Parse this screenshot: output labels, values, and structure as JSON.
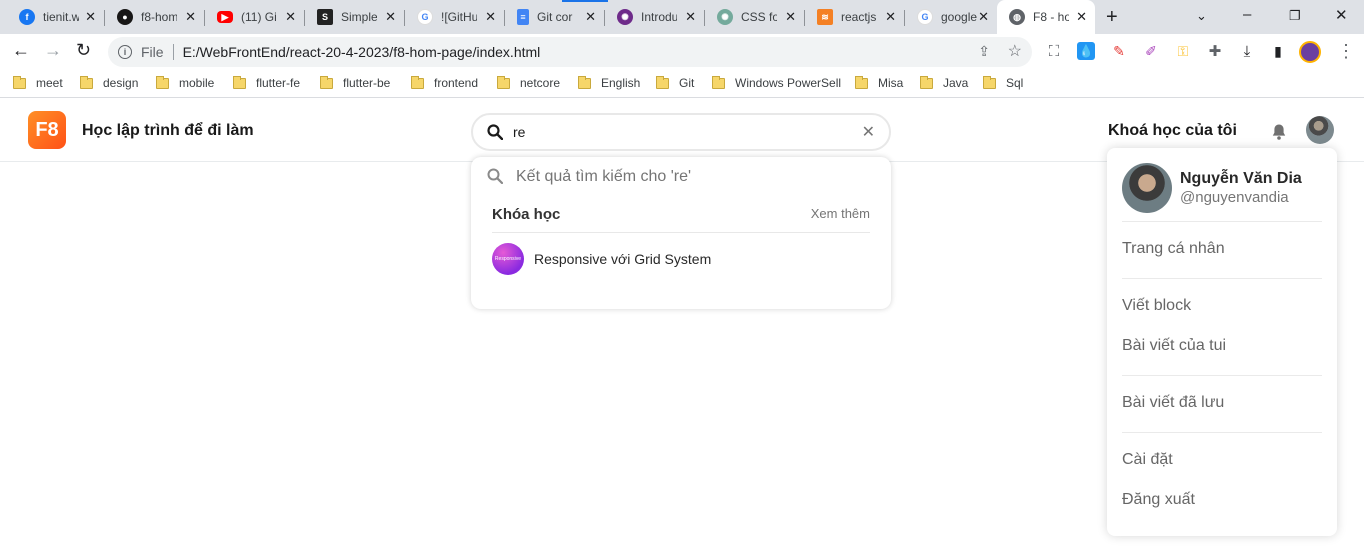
{
  "browser": {
    "tabs": [
      {
        "title": "tienit.w",
        "icon": "facebook-icon",
        "color": "#1877f2"
      },
      {
        "title": "f8-hom",
        "icon": "github-icon",
        "color": "#181717"
      },
      {
        "title": "(11) Gi",
        "icon": "youtube-icon",
        "color": "#ff0000"
      },
      {
        "title": "Simple",
        "icon": "bookmark-icon",
        "color": "#222222"
      },
      {
        "title": "![GitHu",
        "icon": "google-icon",
        "color": "#4285f4"
      },
      {
        "title": "Git cor",
        "icon": "docs-icon",
        "color": "#4285f4"
      },
      {
        "title": "Introdu",
        "icon": "openai-icon",
        "color": "#6e2b8a"
      },
      {
        "title": "CSS fo",
        "icon": "openai-icon",
        "color": "#74aa9c"
      },
      {
        "title": "reactjs",
        "icon": "stackoverflow-icon",
        "color": "#f48024"
      },
      {
        "title": "google",
        "icon": "google-icon",
        "color": "#4285f4"
      },
      {
        "title": "F8 - ho",
        "icon": "globe-icon",
        "color": "#5f6368",
        "active": true
      }
    ],
    "omnibox": {
      "scheme_label": "File",
      "url": "E:/WebFrontEnd/react-20-4-2023/f8-hom-page/index.html"
    },
    "bookmarks": [
      "meet",
      "design",
      "mobile",
      "flutter-fe",
      "flutter-be",
      "frontend",
      "netcore",
      "English",
      "Git",
      "Windows PowerSell",
      "Misa",
      "Java",
      "Sql"
    ]
  },
  "header": {
    "logo_text": "F8",
    "site_title": "Học lập trình để đi làm",
    "search_value": "re",
    "my_courses": "Khoá học của tôi"
  },
  "search_results": {
    "query_text": "Kết quả tìm kiếm cho 're'",
    "section_title": "Khóa học",
    "see_more": "Xem thêm",
    "items": [
      {
        "label": "Responsive với Grid System",
        "thumb_text": "Responsive"
      }
    ]
  },
  "user_menu": {
    "name": "Nguyễn Văn Dia",
    "handle": "@nguyenvandia",
    "items": [
      "Trang cá nhân",
      "Viết block",
      "Bài viết của tui",
      "Bài viết đã lưu",
      "Cài đặt",
      "Đăng xuất"
    ]
  },
  "colors": {
    "brand_orange": "#ff5117",
    "border": "#e8ebed"
  }
}
